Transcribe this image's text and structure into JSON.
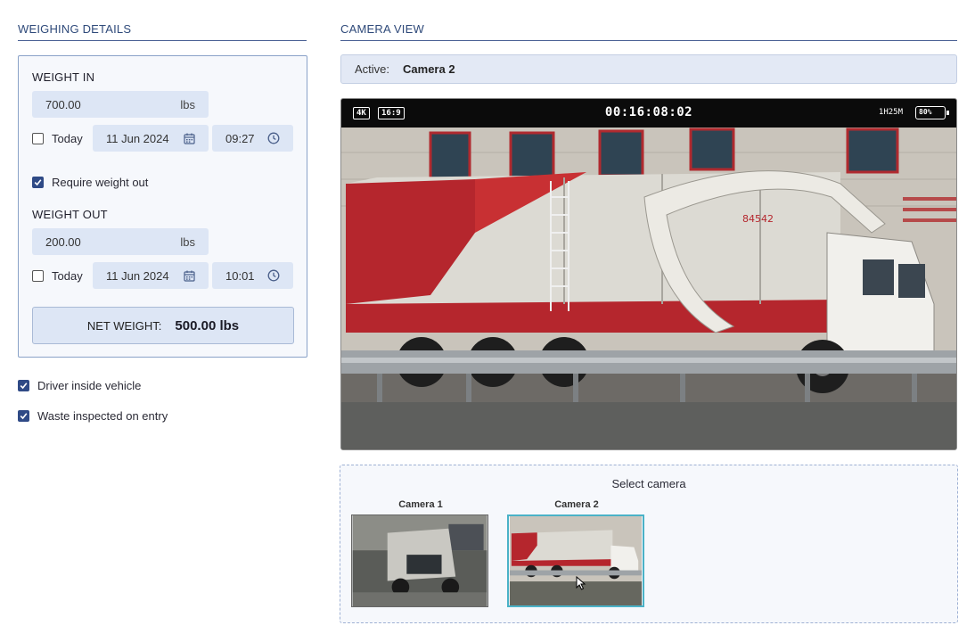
{
  "left": {
    "title": "WEIGHING DETAILS",
    "weight_in": {
      "label": "WEIGHT IN",
      "value": "700.00",
      "unit": "lbs",
      "today_label": "Today",
      "today_checked": false,
      "date": "11 Jun 2024",
      "time": "09:27"
    },
    "require_weight_out": {
      "label": "Require weight out",
      "checked": true
    },
    "weight_out": {
      "label": "WEIGHT OUT",
      "value": "200.00",
      "unit": "lbs",
      "today_label": "Today",
      "today_checked": false,
      "date": "11 Jun 2024",
      "time": "10:01"
    },
    "net_weight": {
      "label": "NET WEIGHT:",
      "value": "500.00 lbs"
    },
    "driver_inside": {
      "label": "Driver inside vehicle",
      "checked": true
    },
    "waste_inspected": {
      "label": "Waste inspected on entry",
      "checked": true
    }
  },
  "right": {
    "title": "CAMERA VIEW",
    "active_label": "Active:",
    "active_camera": "Camera 2",
    "hud": {
      "resolution": "4K",
      "aspect": "16:9",
      "timecode": "00:16:08:02",
      "remaining": "1H25M",
      "battery": "80%",
      "truck_number": "84542"
    },
    "select_title": "Select camera",
    "cameras": [
      {
        "label": "Camera 1",
        "selected": false
      },
      {
        "label": "Camera 2",
        "selected": true
      }
    ]
  },
  "colors": {
    "accent": "#2f4a86",
    "field_bg": "#dde6f5",
    "selected_border": "#4ab2c7"
  }
}
